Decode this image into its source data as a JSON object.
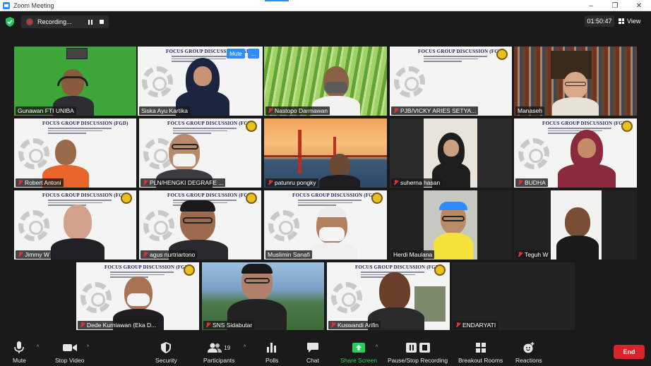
{
  "window": {
    "title": "Zoom Meeting"
  },
  "topbar": {
    "recording_label": "Recording...",
    "timer": "01:50:47",
    "view_label": "View"
  },
  "slide": {
    "heading": "FOCUS GROUP DISCUSSION (FGD)"
  },
  "participants": [
    {
      "name": "Gunawan FTI UNIBA",
      "muted": false
    },
    {
      "name": "Siska Ayu Kartika",
      "muted": false,
      "active_speaker": true
    },
    {
      "name": "Nastopo Darmawan",
      "muted": true
    },
    {
      "name": "PJB/VICKY ARIES SETYA...",
      "muted": true
    },
    {
      "name": "Manaseh",
      "muted": false
    },
    {
      "name": "Robert Antoni",
      "muted": true
    },
    {
      "name": "PLN/HENGKI DEGRAFE ...",
      "muted": true
    },
    {
      "name": "patunru pongky",
      "muted": true
    },
    {
      "name": "suherna hasan",
      "muted": true
    },
    {
      "name": "BUDHA",
      "muted": true
    },
    {
      "name": "Jimmy W",
      "muted": true
    },
    {
      "name": "agus nurtriartono",
      "muted": true
    },
    {
      "name": "Muslimin Sanafi",
      "muted": false
    },
    {
      "name": "Herdi Maulana",
      "muted": false
    },
    {
      "name": "Teguh W",
      "muted": true
    },
    {
      "name": "Dede Kurniawan (Eka D...",
      "muted": true
    },
    {
      "name": "SNS Sidabutar",
      "muted": true
    },
    {
      "name": "Kuswandi Arifin",
      "muted": true
    },
    {
      "name": "ENDARYATI",
      "muted": true
    }
  ],
  "hover_controls": {
    "mute_label": "Mute",
    "more_label": "..."
  },
  "toolbar": {
    "mute": "Mute",
    "stop_video": "Stop Video",
    "security": "Security",
    "participants": "Participants",
    "participant_count": "19",
    "polls": "Polls",
    "chat": "Chat",
    "share_screen": "Share Screen",
    "pause_stop_recording": "Pause/Stop Recording",
    "breakout_rooms": "Breakout Rooms",
    "reactions": "Reactions",
    "end": "End"
  },
  "colors": {
    "accent": "#2d8cff",
    "share_green": "#22d35a",
    "end_red": "#d7262b",
    "active_speaker": "#f5e642",
    "muted_red": "#e03434"
  }
}
